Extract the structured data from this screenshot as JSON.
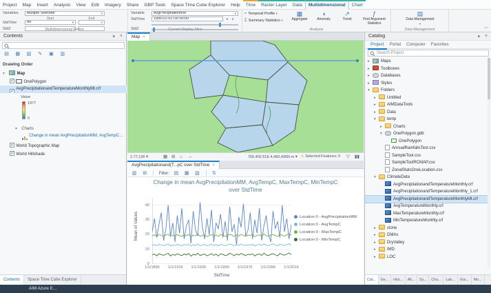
{
  "colors": {
    "accent": "#1f81c9",
    "contextual_teal": "#35b0a4",
    "contextual_orange": "#e8a33d"
  },
  "ribbon": {
    "tabs": [
      "Project",
      "Map",
      "Insert",
      "Analysis",
      "View",
      "Edit",
      "Imagery",
      "Share",
      "GBP Tools",
      "Space Time Cube Explorer",
      "Help"
    ],
    "contextual_tabs": [
      {
        "label": "Time",
        "accent": "#e8a33d"
      },
      {
        "label": "Raster Layer",
        "accent": "#35b0a4"
      },
      {
        "label": "Data",
        "accent": "#35b0a4"
      },
      {
        "label": "Multidimensional",
        "accent": "#35b0a4",
        "active": true
      },
      {
        "label": "Chart",
        "accent": "#35b0a4"
      }
    ],
    "extent_group": {
      "title": "Multidimensional Extent",
      "variables_label": "Variables",
      "variables_value": "Multiple Selected",
      "start_label": "Start",
      "end_label": "End",
      "stdtime_label": "StdTime",
      "stdtime_value": "All",
      "stdz_label": "StdZ"
    },
    "slice_group": {
      "title": "Current Display Slice",
      "variable_label": "Variable",
      "variable_value": "AvgPrecipitationMM",
      "stdtime_label": "StdTime",
      "stdtime_value": "1995-01-01T00:00:00",
      "stdz_label": "StdZ"
    },
    "analysis_group": {
      "title": "Analysis",
      "small_buttons": [
        "Temporal Profile",
        "Summary Statistics"
      ],
      "large_buttons": [
        "Aggregate",
        "Anomaly",
        "Trend",
        "Find Argument Statistics"
      ]
    },
    "data_group": {
      "title": "Data Management",
      "button": "Data Management"
    }
  },
  "contents": {
    "title": "Contents",
    "drawing_order_label": "Drawing Order",
    "map_item": "Map",
    "one_polygon_item": "OnePolygon",
    "crf_layer_item": "AvgPrecipitationandTemperatureMonthlyMt.crf",
    "value_label": "Value",
    "value_max": "1977",
    "value_min": "0",
    "charts_label": "Charts",
    "chart_item": "Change in mean AvgPrecipitationMM, AvgTempC, MaxTempC, MinTempC over StdTime",
    "topo_item": "World Topographic Map",
    "hillshade_item": "World Hillshade",
    "bottom_tabs": [
      "Contents",
      "Space Time Cube Explorer"
    ],
    "active_bottom_tab": "Contents"
  },
  "map_view": {
    "tab": "Map",
    "scale": "1:77,136",
    "coordinates": "765,402.51E 4,460,436N m",
    "selected_features_label": "Selected Features:",
    "selected_features_count": "0"
  },
  "chart_view": {
    "tab": "AvgPrecipitationand(T...pC over StdTime",
    "filter_label": "Filter:"
  },
  "chart_data": {
    "type": "line",
    "title": "Change in mean AvgPrecipitationMM, AvgTempC, MaxTempC, MinTempC over StdTime",
    "title_line1": "Change in mean AvgPrecipitationMM, AvgTempC, MaxTempC, MinTempC",
    "title_line2": "over StdTime",
    "xlabel": "StdTime",
    "ylabel": "Mean of Values",
    "x_tick_labels": [
      "1/1/1896",
      "1/1/1916",
      "1/1/1936",
      "1/1/1956",
      "1/1/1976",
      "1/1/1996",
      "1/1/2016"
    ],
    "x_start_year": 1895,
    "x_step_years": 2,
    "y_ticks": [
      0,
      10,
      20,
      30,
      40
    ],
    "ylim": [
      0,
      45
    ],
    "grid": "horizontal",
    "legend_position": "right",
    "series": [
      {
        "name": "Location 0 - AvgPrecipitationMM",
        "color": "#5b84c4",
        "values": [
          22,
          31,
          18,
          27,
          35,
          16,
          24,
          40,
          19,
          28,
          15,
          33,
          21,
          38,
          17,
          26,
          30,
          14,
          36,
          23,
          19,
          42,
          25,
          17,
          31,
          20,
          37,
          15,
          28,
          24,
          34,
          18,
          29,
          16,
          39,
          22,
          27,
          13,
          32,
          25,
          41,
          19,
          23,
          35,
          17,
          30,
          21,
          38,
          16,
          26,
          33,
          20,
          15,
          36,
          24,
          29,
          18,
          40,
          22,
          31,
          17,
          27
        ]
      },
      {
        "name": "Location 0 - AvgTempC",
        "color": "#77b9d8",
        "values": [
          12.8,
          13.2,
          12.4,
          13.5,
          12.9,
          12.5,
          13.1,
          13.6,
          12.3,
          13.0,
          12.7,
          13.4,
          12.8,
          12.4,
          13.3,
          12.9,
          13.5,
          12.2,
          13.1,
          12.6,
          13.7,
          12.5,
          12.9,
          13.3,
          12.4,
          12.8,
          13.5,
          12.6,
          13.2,
          12.3,
          13.4,
          13.0,
          12.5,
          12.9,
          13.6,
          13.1,
          12.4,
          13.3,
          12.7,
          13.5,
          12.9,
          12.5,
          13.2,
          12.8,
          13.4,
          12.3,
          13.0,
          13.3,
          12.6,
          13.7,
          12.8,
          12.5,
          13.1,
          13.6,
          12.9,
          12.4,
          13.5,
          13.0,
          12.7,
          13.3,
          13.8,
          12.9
        ]
      },
      {
        "name": "Location 0 - MaxTempC",
        "color": "#79ad53",
        "values": [
          19.2,
          19.8,
          18.6,
          20.1,
          19.4,
          18.9,
          19.7,
          20.3,
          18.8,
          19.5,
          19.0,
          20.0,
          19.3,
          18.7,
          19.9,
          19.2,
          20.2,
          18.5,
          19.6,
          19.1,
          20.4,
          18.9,
          19.4,
          19.8,
          18.6,
          19.3,
          20.1,
          19.0,
          19.7,
          18.8,
          20.0,
          19.5,
          18.9,
          19.2,
          20.3,
          19.6,
          18.7,
          19.9,
          19.1,
          20.2,
          19.4,
          18.8,
          19.7,
          19.3,
          20.0,
          18.6,
          19.5,
          19.8,
          19.0,
          20.4,
          19.2,
          18.9,
          19.6,
          20.1,
          19.3,
          18.7,
          20.2,
          19.5,
          19.0,
          19.8,
          20.5,
          19.4
        ]
      },
      {
        "name": "Location 0 - MinTempC",
        "color": "#386f24",
        "values": [
          6.2,
          6.8,
          5.6,
          7.1,
          6.4,
          5.9,
          6.6,
          7.3,
          5.5,
          6.5,
          6.0,
          7.0,
          6.3,
          5.7,
          6.9,
          6.2,
          7.2,
          5.4,
          6.6,
          6.1,
          7.4,
          5.8,
          6.4,
          6.8,
          5.6,
          6.3,
          7.1,
          5.9,
          6.7,
          5.5,
          7.0,
          6.5,
          5.8,
          6.2,
          7.3,
          6.6,
          5.6,
          6.9,
          6.1,
          7.2,
          6.4,
          5.8,
          6.7,
          6.3,
          7.0,
          5.5,
          6.5,
          6.8,
          5.9,
          7.4,
          6.2,
          5.8,
          6.6,
          7.1,
          6.3,
          5.6,
          7.2,
          6.5,
          6.0,
          6.8,
          7.5,
          6.4
        ]
      }
    ]
  },
  "catalog": {
    "title": "Catalog",
    "tabs": [
      "Project",
      "Portal",
      "Computer",
      "Favorites"
    ],
    "active_tab": "Project",
    "search_placeholder": "Search Project",
    "tree": [
      {
        "label": "Maps",
        "level": 0,
        "icon": "maps",
        "arrow": "r"
      },
      {
        "label": "Toolboxes",
        "level": 0,
        "icon": "toolbox",
        "arrow": "r"
      },
      {
        "label": "Databases",
        "level": 0,
        "icon": "db",
        "arrow": "r"
      },
      {
        "label": "Styles",
        "level": 0,
        "icon": "styles",
        "arrow": "r"
      },
      {
        "label": "Folders",
        "level": 0,
        "icon": "folder",
        "arrow": "d"
      },
      {
        "label": "Untitled",
        "level": 1,
        "icon": "folder",
        "arrow": "r"
      },
      {
        "label": "AIMDataTools",
        "level": 1,
        "icon": "folder",
        "arrow": "r"
      },
      {
        "label": "Data",
        "level": 1,
        "icon": "folder",
        "arrow": "r"
      },
      {
        "label": "temp",
        "level": 1,
        "icon": "folder",
        "arrow": "d"
      },
      {
        "label": "Charts",
        "level": 2,
        "icon": "folder",
        "arrow": "r"
      },
      {
        "label": "OnePolygon.gdb",
        "level": 2,
        "icon": "db",
        "arrow": "d"
      },
      {
        "label": "OnePolygon",
        "level": 3,
        "icon": "layer"
      },
      {
        "label": "AnnualRainfallsTest.csv",
        "level": 2,
        "icon": "csv"
      },
      {
        "label": "SampleTool.csv",
        "level": 2,
        "icon": "csv"
      },
      {
        "label": "SampleToolRCMAP.csv",
        "level": 2,
        "icon": "csv"
      },
      {
        "label": "ZonalStatsOneLocation.csv",
        "level": 2,
        "icon": "csv"
      },
      {
        "label": "ClimateData",
        "level": 1,
        "icon": "folder",
        "arrow": "d"
      },
      {
        "label": "AvgPrecipitationandTemperatureMonthly.crf",
        "level": 2,
        "icon": "crf"
      },
      {
        "label": "AvgPrecipitationandTemperatureMonthly_1.crf",
        "level": 2,
        "icon": "crf"
      },
      {
        "label": "AvgPrecipitationandTemperatureMonthlyMt.crf",
        "level": 2,
        "icon": "crf",
        "selected": true
      },
      {
        "label": "AvgTemperatureMonthly.crf",
        "level": 2,
        "icon": "crf"
      },
      {
        "label": "MaxTemperatureMonthly.crf",
        "level": 2,
        "icon": "crf"
      },
      {
        "label": "MinTemperatureMonthly.crf",
        "level": 2,
        "icon": "crf"
      },
      {
        "label": "clone",
        "level": 1,
        "icon": "folder",
        "arrow": "r"
      },
      {
        "label": "DMAs",
        "level": 1,
        "icon": "folder",
        "arrow": "r"
      },
      {
        "label": "DryValley",
        "level": 1,
        "icon": "folder",
        "arrow": "r"
      },
      {
        "label": "IMD",
        "level": 1,
        "icon": "folder",
        "arrow": "r"
      },
      {
        "label": "LOC",
        "level": 1,
        "icon": "folder",
        "arrow": "r"
      }
    ],
    "bottom_tabs": [
      "Cat...",
      "Ge...",
      "Hist...",
      "All...",
      "Sy...",
      "Cha...",
      "Lab...",
      "Vos...",
      "Mo..."
    ]
  },
  "status_bar": {
    "text": "AIM Azure E..."
  },
  "map_data": {
    "background": "#a8df96",
    "feature_fill": "#b7d6eb",
    "feature_stroke": "#45503f",
    "stream_color": "#4f9663",
    "profile_line": {
      "y": 29,
      "x1": 8,
      "x2": 334,
      "color": "#5d9fd3"
    },
    "polygons": [
      "M121,0 L196,0 L214,6 L233,31 L204,57 L148,50 L121,21 Z",
      "M121,21 L148,50 L139,79 L98,84 L90,42 L108,30 Z",
      "M204,57 L233,31 L261,58 L249,93 L201,89 Z",
      "M139,79 L201,89 L196,122 L143,127 L122,103 Z",
      "M143,127 L196,122 L211,152 L160,162 L131,148 Z",
      "M201,89 L249,93 L243,130 L211,152 L196,122 Z"
    ],
    "streams": [
      "M160,50 C150,70 170,85 158,105",
      "M205,95 C215,112 195,125 205,140"
    ]
  }
}
